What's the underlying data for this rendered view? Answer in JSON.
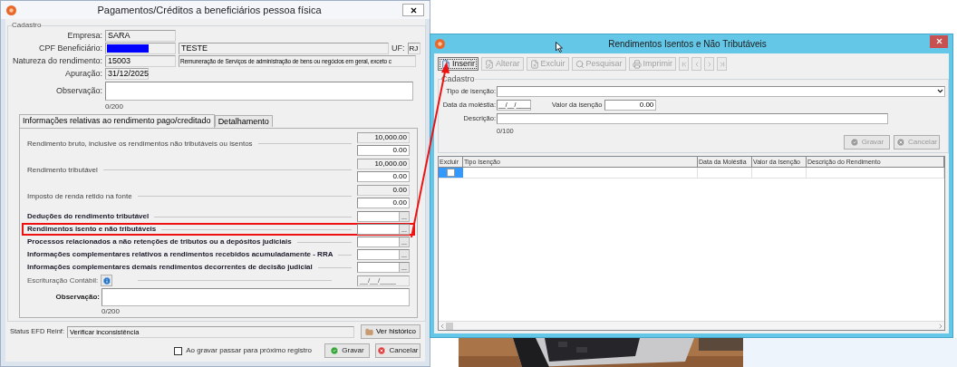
{
  "form_window": {
    "title": "Pagamentos/Créditos a beneficiários pessoa física",
    "section": "Cadastro",
    "empresa": {
      "label": "Empresa:",
      "value": "SARA"
    },
    "beneficiario": {
      "label": "CPF Beneficiário:",
      "name": "TESTE",
      "uf_label": "UF:",
      "uf": "RJ"
    },
    "natureza": {
      "label": "Natureza do rendimento:",
      "code": "15003",
      "description": "Remuneração de Serviços de administração de bens ou negócios em geral, exceto c"
    },
    "apuracao": {
      "label": "Apuração:",
      "value": "31/12/2025"
    },
    "observacao": {
      "label": "Observação:",
      "counter": "0/200"
    },
    "tabs": [
      {
        "label": "Informações relativas ao rendimento pago/creditado",
        "selected": true
      },
      {
        "label": "Detalhamento",
        "selected": false
      }
    ],
    "rows": [
      {
        "kind": "amount",
        "label": "Rendimento bruto, inclusive os rendimentos não tributáveis ou isentos",
        "values": [
          "10,000.00",
          "0.00"
        ],
        "highlighted": false
      },
      {
        "kind": "amount",
        "label": "Rendimento tributável",
        "values": [
          "10,000.00",
          "0.00"
        ],
        "highlighted": false
      },
      {
        "kind": "amount",
        "label": "Imposto de renda retido na fonte",
        "values": [
          "0.00",
          "0.00"
        ],
        "highlighted": false
      },
      {
        "kind": "lookup",
        "label": "Deduções do rendimento tributável",
        "button": "...",
        "highlighted": false
      },
      {
        "kind": "lookup",
        "label": "Rendimentos isento e não tributáveis",
        "button": "...",
        "highlighted": true
      },
      {
        "kind": "lookup",
        "label": "Processos relacionados a não retenções de tributos ou a depósitos judiciais",
        "button": "...",
        "highlighted": false
      },
      {
        "kind": "lookup",
        "label": "Informações complementares relativos a rendimentos recebidos acumuladamente - RRA",
        "button": "...",
        "highlighted": false
      },
      {
        "kind": "lookup",
        "label": "Informações complementares demais rendimentos decorrentes de decisão judicial",
        "button": "...",
        "highlighted": false
      },
      {
        "kind": "date",
        "label": "Escrituração Contábil:",
        "value": "__/__/____",
        "highlighted": false
      }
    ],
    "observacao_2": {
      "label": "Observação:",
      "counter": "0/200"
    },
    "status": {
      "label": "Status EFD Reinf:",
      "value": "Verificar inconsistência",
      "button": "Ver histórico"
    },
    "next_record": {
      "label": "Ao gravar passar para próximo registro",
      "checked": false
    },
    "buttons": [
      {
        "kind": "save",
        "label": "Gravar"
      },
      {
        "kind": "cancel",
        "label": "Cancelar"
      }
    ]
  },
  "exempt_window": {
    "title": "Rendimentos Isentos e Não Tributáveis",
    "toolbar": [
      {
        "kind": "insert",
        "label": "Inserir",
        "disabled": false
      },
      {
        "kind": "edit",
        "label": "Alterar",
        "disabled": true
      },
      {
        "kind": "delete",
        "label": "Excluir",
        "disabled": true
      },
      {
        "kind": "search",
        "label": "Pesquisar",
        "disabled": true
      },
      {
        "kind": "print",
        "label": "Imprimir",
        "disabled": true
      },
      {
        "kind": "first",
        "disabled": true
      },
      {
        "kind": "previous",
        "disabled": true
      },
      {
        "kind": "next",
        "disabled": true
      },
      {
        "kind": "last",
        "disabled": true
      }
    ],
    "section": "Cadastro",
    "tipo": {
      "label": "Tipo de isenção:"
    },
    "data": {
      "label": "Data da moléstia:",
      "value": "__/__/____"
    },
    "valor": {
      "label": "Valor da isenção",
      "value": "0.00"
    },
    "descricao": {
      "label": "Descrição:",
      "counter": "0/100"
    },
    "buttons": [
      {
        "kind": "save",
        "label": "Gravar",
        "disabled": true
      },
      {
        "kind": "cancel",
        "label": "Cancelar",
        "disabled": true
      }
    ],
    "grid": {
      "columns": [
        "Excluir",
        "Tipo Isenção",
        "Data da Moléstia",
        "Valor da Isenção",
        "Descrição do Rendimento"
      ],
      "rows": [
        {
          "checked": false
        }
      ]
    }
  }
}
